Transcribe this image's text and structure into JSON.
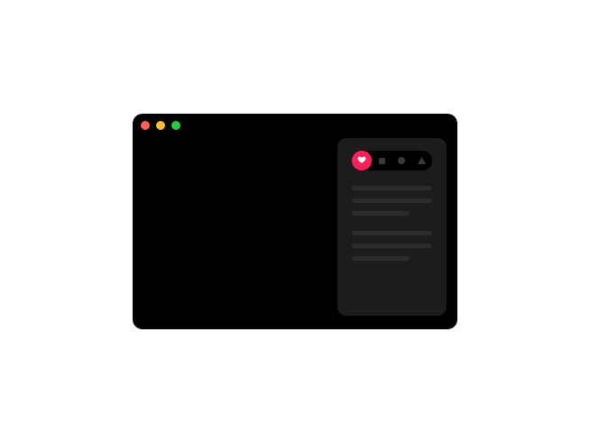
{
  "window": {
    "controls": [
      {
        "name": "close",
        "color": "#ff5f57"
      },
      {
        "name": "minimize",
        "color": "#febc2e"
      },
      {
        "name": "zoom",
        "color": "#28c840"
      }
    ]
  },
  "panel": {
    "segments": [
      {
        "icon": "heart-icon",
        "active": true
      },
      {
        "icon": "square-icon",
        "active": false
      },
      {
        "icon": "circle-icon",
        "active": false
      },
      {
        "icon": "triangle-icon",
        "active": false
      }
    ],
    "accent_color": "#ff1f5a",
    "background_color": "#1c1c1e"
  }
}
